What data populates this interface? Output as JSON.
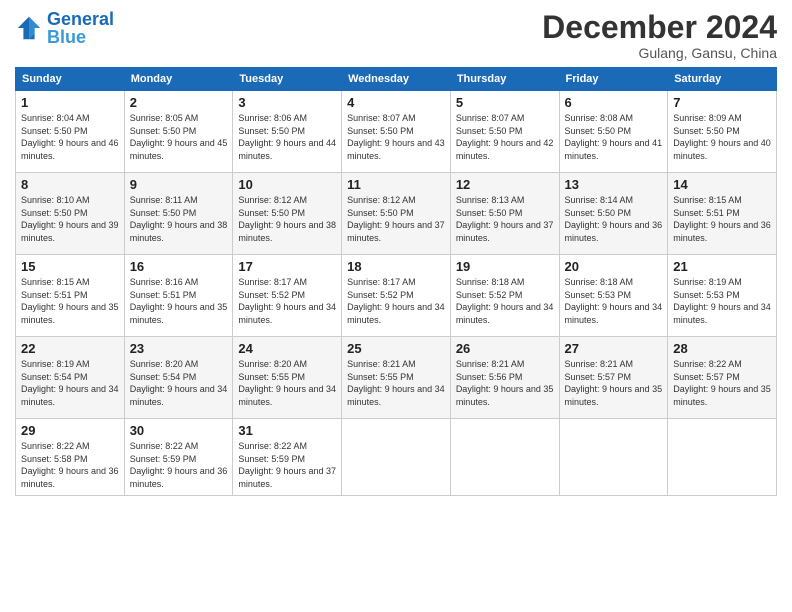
{
  "header": {
    "logo_text_general": "General",
    "logo_text_blue": "Blue",
    "title": "December 2024",
    "subtitle": "Gulang, Gansu, China"
  },
  "calendar": {
    "days_of_week": [
      "Sunday",
      "Monday",
      "Tuesday",
      "Wednesday",
      "Thursday",
      "Friday",
      "Saturday"
    ],
    "weeks": [
      [
        null,
        {
          "num": "2",
          "sunrise": "8:05 AM",
          "sunset": "5:50 PM",
          "daylight": "9 hours and 45 minutes."
        },
        {
          "num": "3",
          "sunrise": "8:06 AM",
          "sunset": "5:50 PM",
          "daylight": "9 hours and 44 minutes."
        },
        {
          "num": "4",
          "sunrise": "8:07 AM",
          "sunset": "5:50 PM",
          "daylight": "9 hours and 43 minutes."
        },
        {
          "num": "5",
          "sunrise": "8:07 AM",
          "sunset": "5:50 PM",
          "daylight": "9 hours and 42 minutes."
        },
        {
          "num": "6",
          "sunrise": "8:08 AM",
          "sunset": "5:50 PM",
          "daylight": "9 hours and 41 minutes."
        },
        {
          "num": "7",
          "sunrise": "8:09 AM",
          "sunset": "5:50 PM",
          "daylight": "9 hours and 40 minutes."
        }
      ],
      [
        {
          "num": "1",
          "sunrise": "8:04 AM",
          "sunset": "5:50 PM",
          "daylight": "9 hours and 46 minutes."
        },
        {
          "num": "9",
          "sunrise": "8:11 AM",
          "sunset": "5:50 PM",
          "daylight": "9 hours and 38 minutes."
        },
        {
          "num": "10",
          "sunrise": "8:12 AM",
          "sunset": "5:50 PM",
          "daylight": "9 hours and 38 minutes."
        },
        {
          "num": "11",
          "sunrise": "8:12 AM",
          "sunset": "5:50 PM",
          "daylight": "9 hours and 37 minutes."
        },
        {
          "num": "12",
          "sunrise": "8:13 AM",
          "sunset": "5:50 PM",
          "daylight": "9 hours and 37 minutes."
        },
        {
          "num": "13",
          "sunrise": "8:14 AM",
          "sunset": "5:50 PM",
          "daylight": "9 hours and 36 minutes."
        },
        {
          "num": "14",
          "sunrise": "8:15 AM",
          "sunset": "5:51 PM",
          "daylight": "9 hours and 36 minutes."
        }
      ],
      [
        {
          "num": "8",
          "sunrise": "8:10 AM",
          "sunset": "5:50 PM",
          "daylight": "9 hours and 39 minutes."
        },
        {
          "num": "16",
          "sunrise": "8:16 AM",
          "sunset": "5:51 PM",
          "daylight": "9 hours and 35 minutes."
        },
        {
          "num": "17",
          "sunrise": "8:17 AM",
          "sunset": "5:52 PM",
          "daylight": "9 hours and 34 minutes."
        },
        {
          "num": "18",
          "sunrise": "8:17 AM",
          "sunset": "5:52 PM",
          "daylight": "9 hours and 34 minutes."
        },
        {
          "num": "19",
          "sunrise": "8:18 AM",
          "sunset": "5:52 PM",
          "daylight": "9 hours and 34 minutes."
        },
        {
          "num": "20",
          "sunrise": "8:18 AM",
          "sunset": "5:53 PM",
          "daylight": "9 hours and 34 minutes."
        },
        {
          "num": "21",
          "sunrise": "8:19 AM",
          "sunset": "5:53 PM",
          "daylight": "9 hours and 34 minutes."
        }
      ],
      [
        {
          "num": "15",
          "sunrise": "8:15 AM",
          "sunset": "5:51 PM",
          "daylight": "9 hours and 35 minutes."
        },
        {
          "num": "23",
          "sunrise": "8:20 AM",
          "sunset": "5:54 PM",
          "daylight": "9 hours and 34 minutes."
        },
        {
          "num": "24",
          "sunrise": "8:20 AM",
          "sunset": "5:55 PM",
          "daylight": "9 hours and 34 minutes."
        },
        {
          "num": "25",
          "sunrise": "8:21 AM",
          "sunset": "5:55 PM",
          "daylight": "9 hours and 34 minutes."
        },
        {
          "num": "26",
          "sunrise": "8:21 AM",
          "sunset": "5:56 PM",
          "daylight": "9 hours and 35 minutes."
        },
        {
          "num": "27",
          "sunrise": "8:21 AM",
          "sunset": "5:57 PM",
          "daylight": "9 hours and 35 minutes."
        },
        {
          "num": "28",
          "sunrise": "8:22 AM",
          "sunset": "5:57 PM",
          "daylight": "9 hours and 35 minutes."
        }
      ],
      [
        {
          "num": "22",
          "sunrise": "8:19 AM",
          "sunset": "5:54 PM",
          "daylight": "9 hours and 34 minutes."
        },
        {
          "num": "30",
          "sunrise": "8:22 AM",
          "sunset": "5:59 PM",
          "daylight": "9 hours and 36 minutes."
        },
        {
          "num": "31",
          "sunrise": "8:22 AM",
          "sunset": "5:59 PM",
          "daylight": "9 hours and 37 minutes."
        },
        null,
        null,
        null,
        null
      ],
      [
        {
          "num": "29",
          "sunrise": "8:22 AM",
          "sunset": "5:58 PM",
          "daylight": "9 hours and 36 minutes."
        },
        null,
        null,
        null,
        null,
        null,
        null
      ]
    ],
    "row_order": [
      [
        0,
        1,
        2,
        3,
        4,
        5,
        6
      ],
      [
        1,
        1,
        1,
        1,
        1,
        1,
        1
      ],
      [
        2,
        2,
        2,
        2,
        2,
        2,
        2
      ],
      [
        3,
        3,
        3,
        3,
        3,
        3,
        3
      ],
      [
        4,
        4,
        4,
        4,
        4,
        4,
        4
      ],
      [
        5,
        5,
        5,
        5,
        5,
        5,
        5
      ]
    ]
  }
}
